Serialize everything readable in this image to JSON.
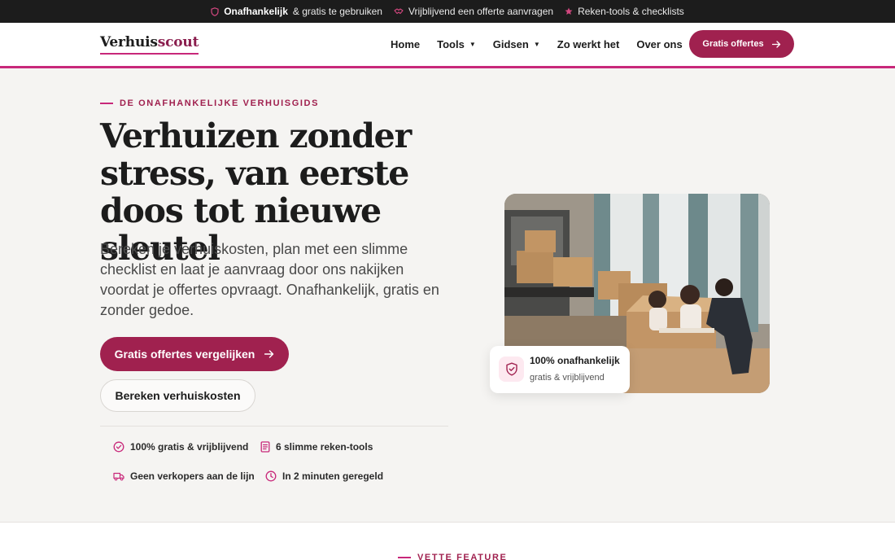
{
  "topbar": {
    "item1_bold": "Onafhankelijk",
    "item1_rest": "& gratis te gebruiken",
    "item2": "Vrijblijvend een offerte aanvragen",
    "item3": "Reken-tools & checklists"
  },
  "header": {
    "logo_part1": "Verhuis",
    "logo_part2": "scout",
    "nav": {
      "home": "Home",
      "tools": "Tools",
      "gidsen": "Gidsen",
      "zo_werkt_het": "Zo werkt het",
      "over_ons": "Over ons"
    },
    "cta": "Gratis offertes"
  },
  "hero": {
    "eyebrow": "DE ONAFHANKELIJKE VERHUISGIDS",
    "title": "Verhuizen zonder stress, van eerste doos tot nieuwe sleutel",
    "lead": "Bereken je verhuiskosten, plan met een slimme checklist en laat je aanvraag door ons nakijken voordat je offertes opvraagt. Onafhankelijk, gratis en zonder gedoe.",
    "primary_cta": "Gratis offertes vergelijken",
    "secondary_cta": "Bereken verhuiskosten",
    "features": {
      "f1": "100% gratis & vrijblijvend",
      "f2": "6 slimme reken-tools",
      "f3": "Geen verkopers aan de lijn",
      "f4": "In 2 minuten geregeld"
    }
  },
  "badge": {
    "title": "100% onafhankelijk",
    "subtitle": "gratis & vrijblijvend"
  },
  "next_section": {
    "eyebrow": "VETTE FEATURE"
  },
  "colors": {
    "accent": "#a0214f",
    "accent_line": "#c8287a",
    "topbar_bg": "#1c1c1c",
    "hero_bg": "#f5f4f2"
  },
  "icons": [
    "shield-icon",
    "handshake-icon",
    "star-icon",
    "arrow-right-icon",
    "check-circle-icon",
    "document-icon",
    "truck-icon",
    "clock-icon",
    "shield-check-icon"
  ]
}
